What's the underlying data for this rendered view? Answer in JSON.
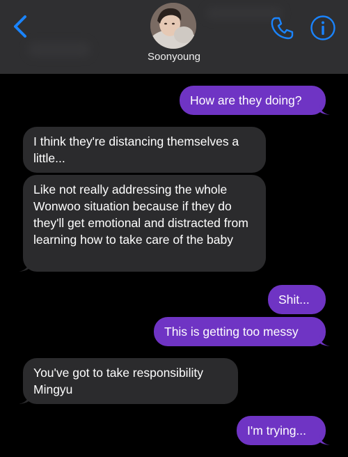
{
  "header": {
    "contact_name": "Soonyoung",
    "colors": {
      "accent": "#1a84ff",
      "header_bg": "#2f2f31",
      "sent_bubble": "#6f34c4",
      "received_bubble": "#2b2b2d"
    },
    "icons": {
      "back": "chevron-left-icon",
      "phone": "phone-icon",
      "info": "info-icon"
    }
  },
  "messages": [
    {
      "side": "sent",
      "text": "How are they doing?"
    },
    {
      "side": "received",
      "text": "I think they're distancing themselves a little..."
    },
    {
      "side": "received",
      "text": "Like not really addressing the whole Wonwoo situation because if they do they'll get emotional and distracted from learning how to take care of the baby"
    },
    {
      "side": "sent",
      "text": "Shit..."
    },
    {
      "side": "sent",
      "text": "This is getting too messy"
    },
    {
      "side": "received",
      "text": "You've got to take responsibility Mingyu"
    },
    {
      "side": "sent",
      "text": "I'm trying..."
    }
  ]
}
